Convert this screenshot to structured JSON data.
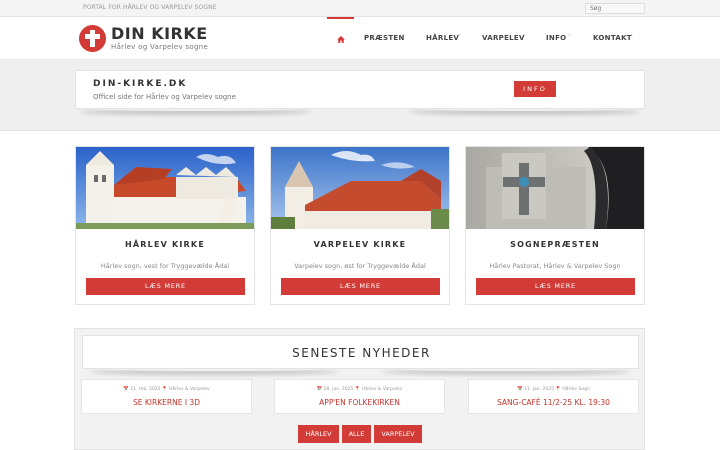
{
  "topbar": {
    "tagline": "PORTAL FOR HÅRLEV OG VARPELEV SOGNE",
    "search_placeholder": "Søg"
  },
  "logo": {
    "title": "DIN KIRKE",
    "subtitle": "Hårlev og Varpelev sogne",
    "icon": "cross-icon"
  },
  "nav": {
    "home_icon": "home-icon",
    "items": [
      {
        "label": "PRÆSTEN",
        "chevron": "˅"
      },
      {
        "label": "HÅRLEV",
        "chevron": "˅"
      },
      {
        "label": "VARPELEV",
        "chevron": "˅"
      },
      {
        "label": "INFO",
        "chevron": "˅"
      },
      {
        "label": "KONTAKT",
        "chevron": "˅"
      }
    ]
  },
  "banner": {
    "title": "DIN-KIRKE.DK",
    "subtitle": "Officel side for Hårlev og Varpelev sogne",
    "button": "INFO"
  },
  "cards": [
    {
      "title": "HÅRLEV KIRKE",
      "desc": "Hårlev sogn, vest for Tryggevælde Ådal",
      "button": "LÆS MERE"
    },
    {
      "title": "VARPELEV KIRKE",
      "desc": "Varpelev sogn, øst for Tryggevælde Ådal",
      "button": "LÆS MERE"
    },
    {
      "title": "SOGNEPRÆSTEN",
      "desc": "Hårlev Pastorat, Hårlev & Varpelev Sogn",
      "button": "LÆS MERE"
    }
  ],
  "news": {
    "title": "SENESTE NYHEDER",
    "items": [
      {
        "meta": "📅 21. feb. 2025 📍 Hårlev & Varpelev",
        "headline": "SE KIRKERNE I 3D"
      },
      {
        "meta": "📅 28. jan. 2025 📍 Hårlev & Varpelev",
        "headline": "APP'EN FOLKEKIRKEN"
      },
      {
        "meta": "📅 11. jan. 2025 📍 Hårlev Sogn",
        "headline": "SANG-CAFÉ 11/2-25 KL. 19:30"
      }
    ],
    "filters": [
      "HÅRLEV",
      "ALLE",
      "VARPELEV"
    ]
  },
  "colors": {
    "accent": "#d33b37",
    "text_dark": "#333333"
  }
}
